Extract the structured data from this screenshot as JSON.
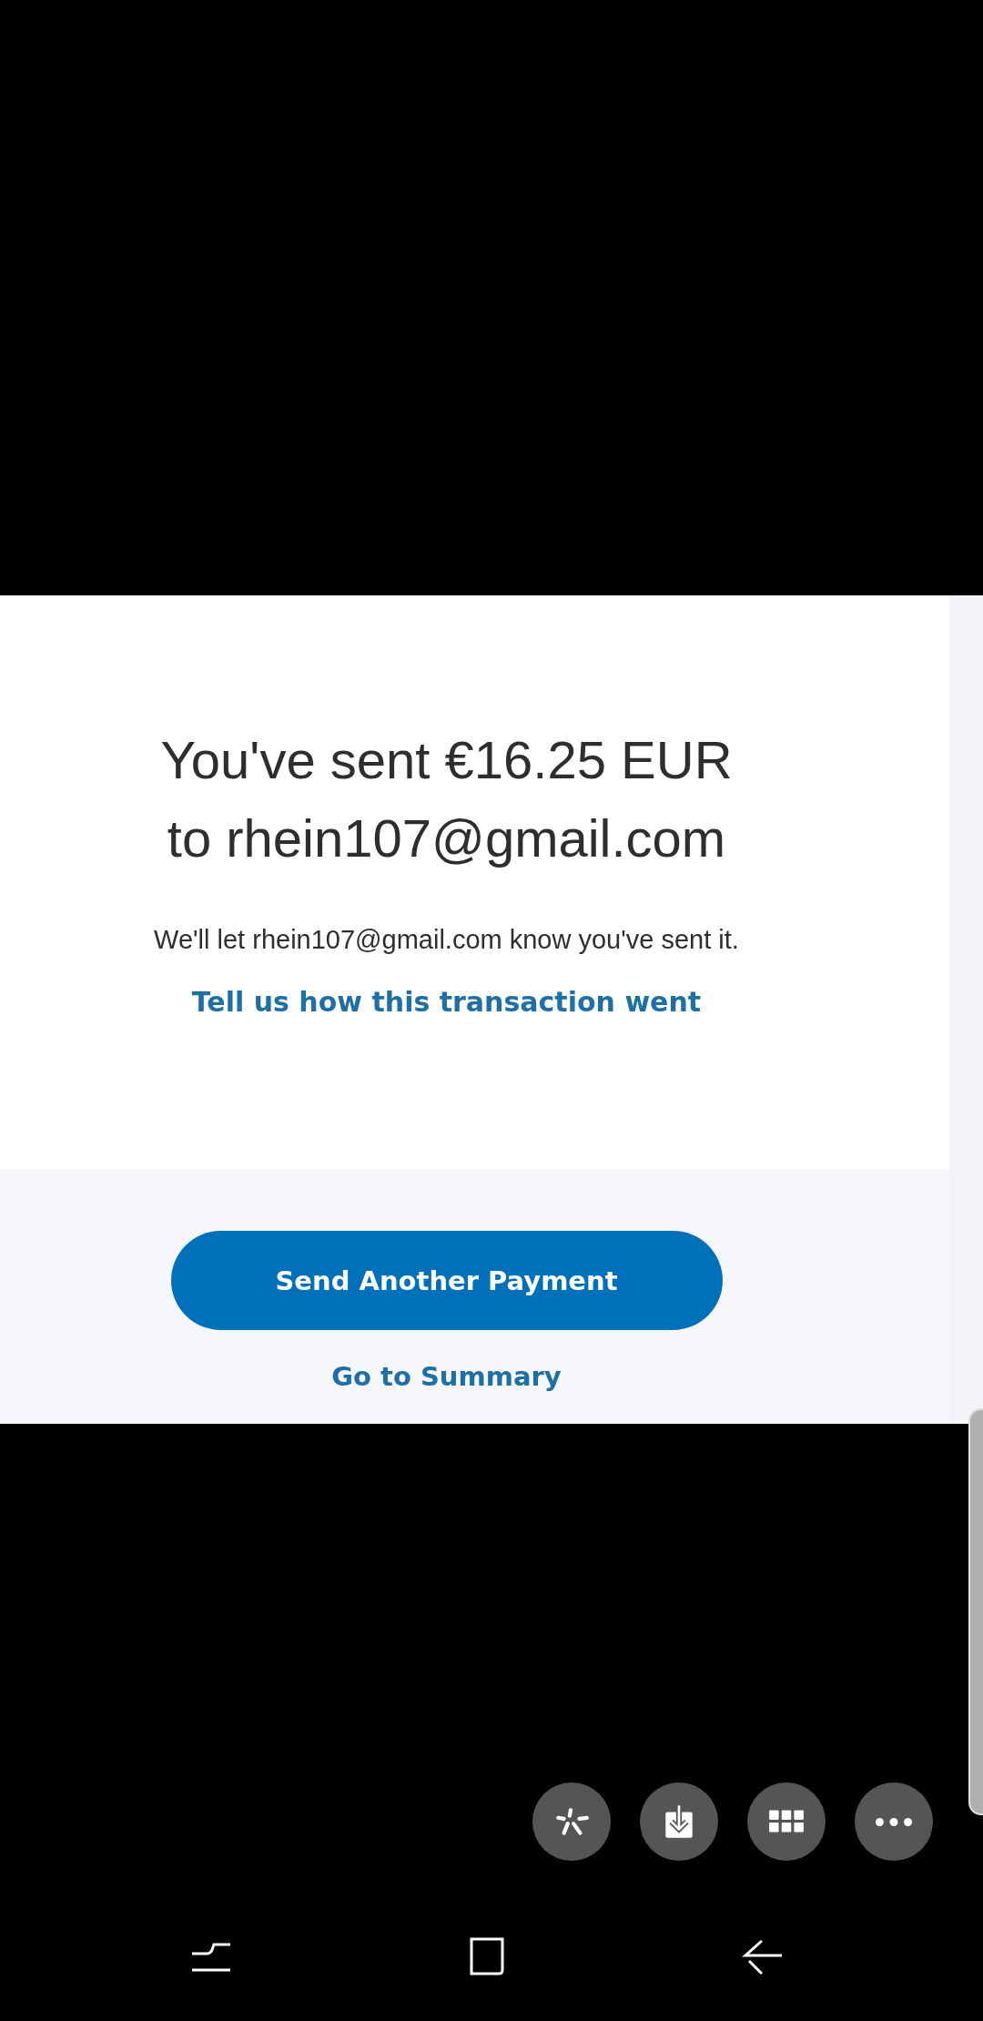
{
  "confirmation": {
    "heading_lines": [
      "You've sent €16.25 EUR",
      "to rhein107@gmail.com"
    ],
    "message": "We'll let rhein107@gmail.com know you've sent it.",
    "feedback_link": "Tell us how this transaction went"
  },
  "actions": {
    "primary_button": "Send Another Payment",
    "secondary_link": "Go to Summary"
  }
}
